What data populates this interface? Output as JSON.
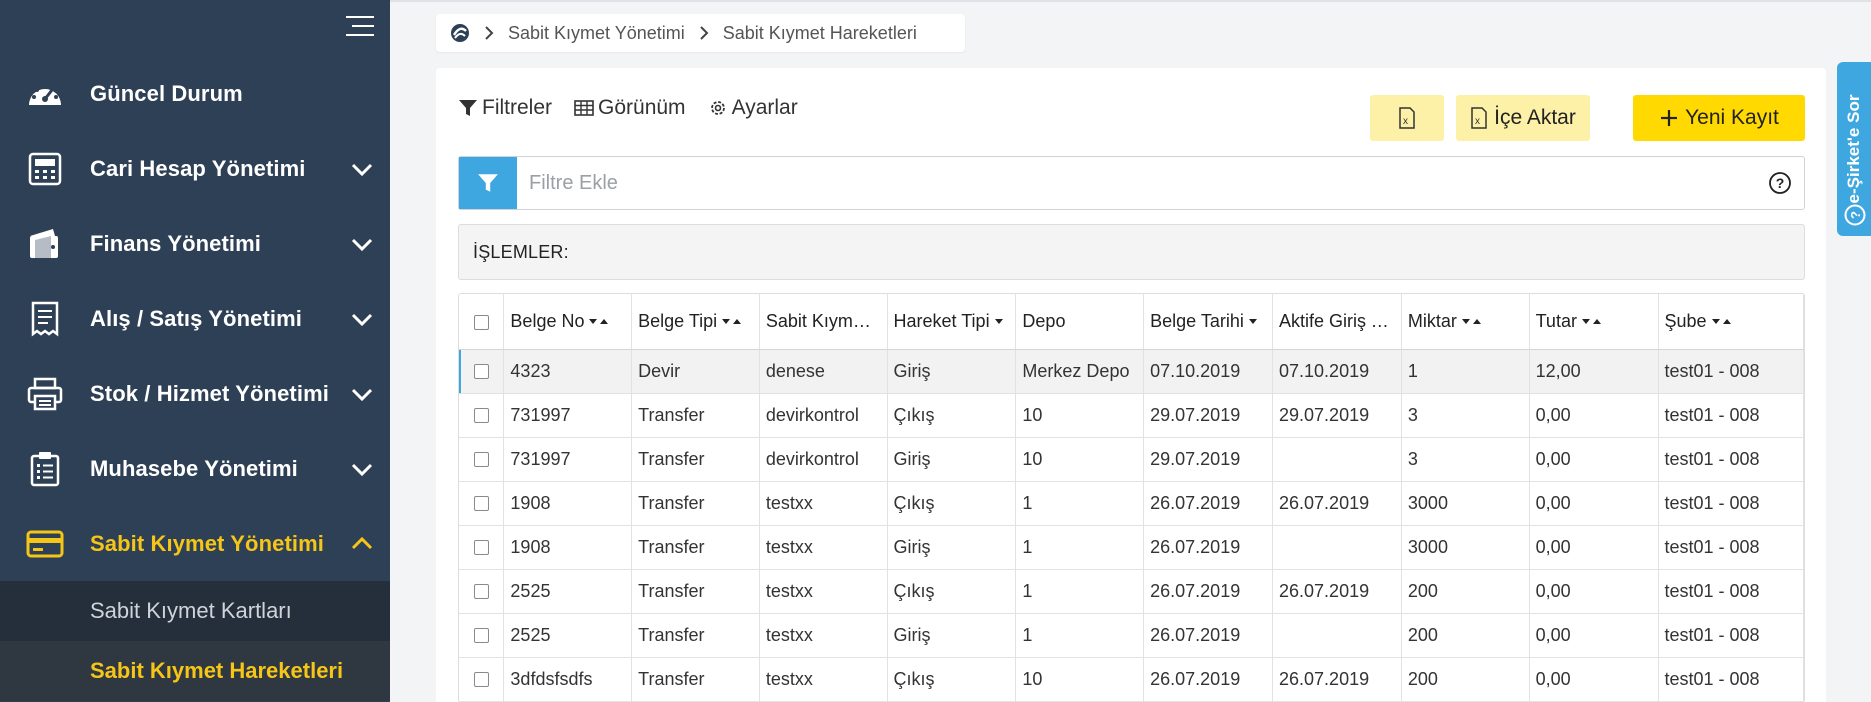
{
  "sidebar": {
    "items": [
      {
        "label": "Güncel Durum",
        "icon": "dashboard-gauge-icon"
      },
      {
        "label": "Cari Hesap Yönetimi",
        "icon": "calculator-icon"
      },
      {
        "label": "Finans Yönetimi",
        "icon": "wallet-icon"
      },
      {
        "label": "Alış / Satış Yönetimi",
        "icon": "receipt-icon"
      },
      {
        "label": "Stok / Hizmet Yönetimi",
        "icon": "printer-box-icon"
      },
      {
        "label": "Muhasebe Yönetimi",
        "icon": "clipboard-list-icon"
      },
      {
        "label": "Sabit Kıymet Yönetimi",
        "icon": "credit-card-icon",
        "active": true
      }
    ],
    "sub_items": [
      {
        "label": "Sabit Kıymet Kartları"
      },
      {
        "label": "Sabit Kıymet Hareketleri",
        "active": true
      }
    ]
  },
  "breadcrumb": {
    "items": [
      "Sabit Kıymet Yönetimi",
      "Sabit Kıymet Hareketleri"
    ]
  },
  "toolbar": {
    "filters_label": "Filtreler",
    "view_label": "Görünüm",
    "settings_label": "Ayarlar",
    "import_label": "İçe Aktar",
    "new_label": "Yeni Kayıt"
  },
  "filter": {
    "placeholder": "Filtre Ekle"
  },
  "operations": {
    "label": "İŞLEMLER:"
  },
  "table": {
    "columns": [
      "Belge No",
      "Belge Tipi",
      "Sabit Kıymet Adı",
      "Hareket Tipi",
      "Depo",
      "Belge Tarihi",
      "Aktife Giriş Tarihi",
      "Miktar",
      "Tutar",
      "Şube"
    ],
    "rows": [
      [
        "4323",
        "Devir",
        "denese",
        "Giriş",
        "Merkez Depo",
        "07.10.2019",
        "07.10.2019",
        "1",
        "12,00",
        "test01 - 008"
      ],
      [
        "731997",
        "Transfer",
        "devirkontrol",
        "Çıkış",
        "10",
        "29.07.2019",
        "29.07.2019",
        "3",
        "0,00",
        "test01 - 008"
      ],
      [
        "731997",
        "Transfer",
        "devirkontrol",
        "Giriş",
        "10",
        "29.07.2019",
        "",
        "3",
        "0,00",
        "test01 - 008"
      ],
      [
        "1908",
        "Transfer",
        "testxx",
        "Çıkış",
        "1",
        "26.07.2019",
        "26.07.2019",
        "3000",
        "0,00",
        "test01 - 008"
      ],
      [
        "1908",
        "Transfer",
        "testxx",
        "Giriş",
        "1",
        "26.07.2019",
        "",
        "3000",
        "0,00",
        "test01 - 008"
      ],
      [
        "2525",
        "Transfer",
        "testxx",
        "Çıkış",
        "1",
        "26.07.2019",
        "26.07.2019",
        "200",
        "0,00",
        "test01 - 008"
      ],
      [
        "2525",
        "Transfer",
        "testxx",
        "Giriş",
        "1",
        "26.07.2019",
        "",
        "200",
        "0,00",
        "test01 - 008"
      ],
      [
        "3dfdsfsdfs",
        "Transfer",
        "testxx",
        "Çıkış",
        "10",
        "26.07.2019",
        "26.07.2019",
        "200",
        "0,00",
        "test01 - 008"
      ]
    ]
  },
  "side_tab": {
    "label": "e-Şirket'e Sor"
  },
  "colors": {
    "sidebar_bg": "#2e4055",
    "accent_yellow": "#f5c518",
    "button_yellow": "#ffd900",
    "button_light_yellow": "#fdf1a8",
    "accent_blue": "#3ea7e0"
  }
}
